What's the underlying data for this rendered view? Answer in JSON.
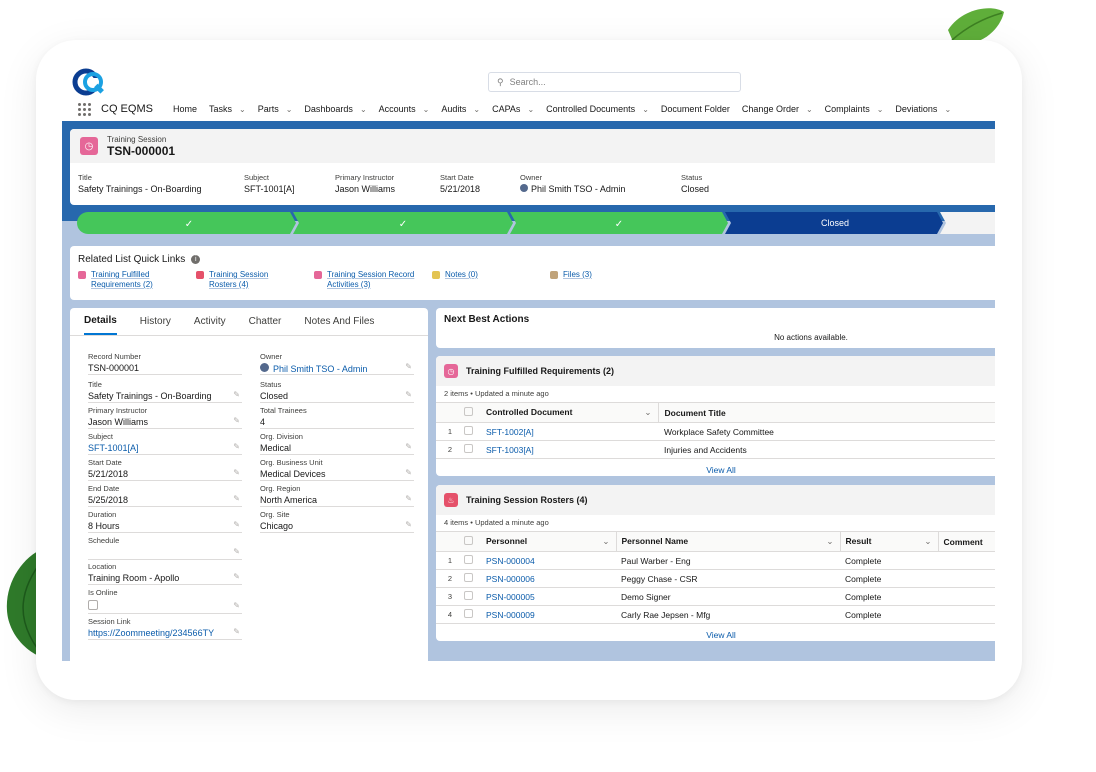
{
  "header": {
    "search_placeholder": "Search...",
    "app_name": "CQ EQMS",
    "nav": [
      {
        "label": "Home",
        "has_menu": false
      },
      {
        "label": "Tasks",
        "has_menu": true
      },
      {
        "label": "Parts",
        "has_menu": true
      },
      {
        "label": "Dashboards",
        "has_menu": true
      },
      {
        "label": "Accounts",
        "has_menu": true
      },
      {
        "label": "Audits",
        "has_menu": true
      },
      {
        "label": "CAPAs",
        "has_menu": true
      },
      {
        "label": "Controlled Documents",
        "has_menu": true
      },
      {
        "label": "Document Folder",
        "has_menu": false
      },
      {
        "label": "Change Order",
        "has_menu": true
      },
      {
        "label": "Complaints",
        "has_menu": true
      },
      {
        "label": "Deviations",
        "has_menu": true
      }
    ]
  },
  "record": {
    "type": "Training Session",
    "name": "TSN-000001",
    "highlights": [
      {
        "label": "Title",
        "value": "Safety Trainings - On-Boarding"
      },
      {
        "label": "Subject",
        "value": "SFT-1001[A]"
      },
      {
        "label": "Primary Instructor",
        "value": "Jason Williams"
      },
      {
        "label": "Start Date",
        "value": "5/21/2018"
      },
      {
        "label": "Owner",
        "value": "Phil Smith TSO - Admin"
      },
      {
        "label": "Status",
        "value": "Closed"
      }
    ]
  },
  "path": {
    "steps": [
      "✓",
      "✓",
      "✓",
      "Closed",
      ""
    ]
  },
  "quick_links": {
    "title": "Related List Quick Links",
    "items": [
      {
        "line1": "Training Fulfilled",
        "line2": "Requirements (2)",
        "color": "#e56798"
      },
      {
        "line1": "Training Session",
        "line2": "Rosters (4)",
        "color": "#e5516a"
      },
      {
        "line1": "Training Session Record",
        "line2": "Activities (3)",
        "color": "#e56798"
      },
      {
        "line1": "Notes (0)",
        "line2": "",
        "color": "#e3c452"
      },
      {
        "line1": "Files (3)",
        "line2": "",
        "color": "#c0a37a"
      }
    ]
  },
  "details": {
    "tabs": [
      "Details",
      "History",
      "Activity",
      "Chatter",
      "Notes And Files"
    ],
    "left": [
      {
        "label": "Record Number",
        "value": "TSN-000001"
      },
      {
        "label": "Title",
        "value": "Safety Trainings - On-Boarding"
      },
      {
        "label": "Primary Instructor",
        "value": "Jason Williams"
      },
      {
        "label": "Subject",
        "value": "SFT-1001[A]"
      },
      {
        "label": "Start Date",
        "value": "5/21/2018"
      },
      {
        "label": "End Date",
        "value": "5/25/2018"
      },
      {
        "label": "Duration",
        "value": "8 Hours"
      },
      {
        "label": "Schedule",
        "value": ""
      },
      {
        "label": "Location",
        "value": "Training Room - Apollo"
      },
      {
        "label": "Is Online",
        "value": ""
      },
      {
        "label": "Session Link",
        "value": "https://Zoommeeting/234566TY"
      }
    ],
    "right": [
      {
        "label": "Owner",
        "value": "Phil Smith TSO - Admin"
      },
      {
        "label": "Status",
        "value": "Closed"
      },
      {
        "label": "Total Trainees",
        "value": "4"
      },
      {
        "label": "Org. Division",
        "value": "Medical"
      },
      {
        "label": "Org. Business Unit",
        "value": "Medical Devices"
      },
      {
        "label": "Org. Region",
        "value": "North America"
      },
      {
        "label": "Org. Site",
        "value": "Chicago"
      }
    ]
  },
  "next_best_actions": {
    "title": "Next Best Actions",
    "empty": "No actions available."
  },
  "fulfilled": {
    "title": "Training Fulfilled Requirements (2)",
    "sub": "2 items • Updated a minute ago",
    "columns": [
      "Controlled Document",
      "Document Title"
    ],
    "rows": [
      {
        "num": "1",
        "doc": "SFT-1002[A]",
        "title": "Workplace Safety Committee"
      },
      {
        "num": "2",
        "doc": "SFT-1003[A]",
        "title": "Injuries and Accidents"
      }
    ],
    "view_all": "View All"
  },
  "rosters": {
    "title": "Training Session Rosters (4)",
    "sub": "4 items • Updated a minute ago",
    "columns": [
      "Personnel",
      "Personnel Name",
      "Result",
      "Comment"
    ],
    "rows": [
      {
        "num": "1",
        "id": "PSN-000004",
        "name": "Paul Warber - Eng",
        "result": "Complete"
      },
      {
        "num": "2",
        "id": "PSN-000006",
        "name": "Peggy Chase - CSR",
        "result": "Complete"
      },
      {
        "num": "3",
        "id": "PSN-000005",
        "name": "Demo Signer",
        "result": "Complete"
      },
      {
        "num": "4",
        "id": "PSN-000009",
        "name": "Carly Rae Jepsen - Mfg",
        "result": "Complete"
      }
    ],
    "view_all": "View All"
  }
}
